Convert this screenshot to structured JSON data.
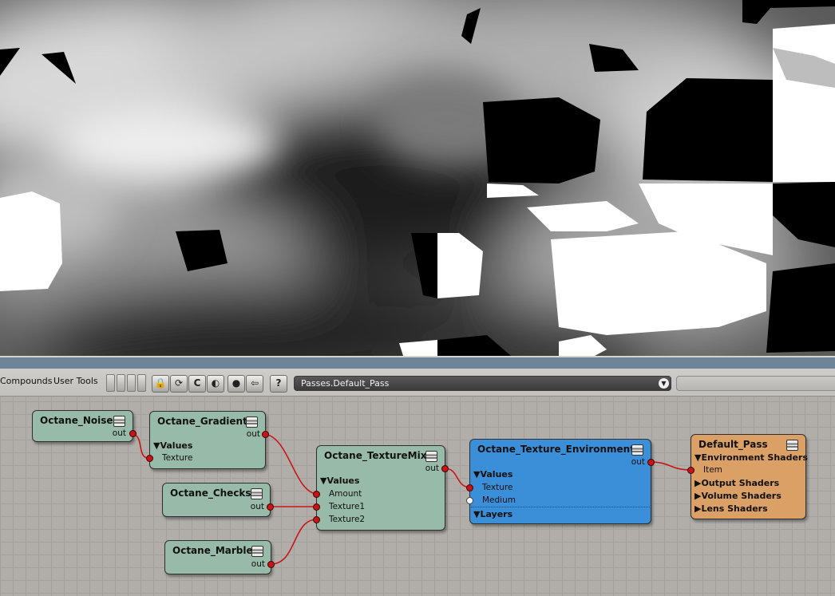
{
  "toolbar": {
    "compounds_label": "Compounds",
    "user_tools_label": "User Tools",
    "pass_value": "Passes.Default_Pass"
  },
  "nodes": {
    "noise": {
      "title": "Octane_Noise",
      "out": "out"
    },
    "gradient": {
      "title": "Octane_Gradient",
      "out": "out",
      "section": "▼Values",
      "inputs": [
        "Texture"
      ]
    },
    "checks": {
      "title": "Octane_Checks",
      "out": "out"
    },
    "marble": {
      "title": "Octane_Marble",
      "out": "out"
    },
    "texmix": {
      "title": "Octane_TextureMix",
      "out": "out",
      "section": "▼Values",
      "inputs": [
        "Amount",
        "Texture1",
        "Texture2"
      ]
    },
    "env": {
      "title": "Octane_Texture_Environment",
      "out": "out",
      "section": "▼Values",
      "inputs": [
        "Texture",
        "Medium"
      ],
      "layers": "▼Layers"
    },
    "pass": {
      "title": "Default_Pass",
      "sections": [
        "▼Environment Shaders",
        "▶Output Shaders",
        "▶Volume Shaders",
        "▶Lens Shaders"
      ],
      "item": "Item"
    }
  },
  "colors": {
    "node_green": "#97bba8",
    "node_blue": "#3b8fd9",
    "node_orange": "#dba066",
    "wire": "#c81414",
    "graph_bg": "#b1aeaa"
  }
}
